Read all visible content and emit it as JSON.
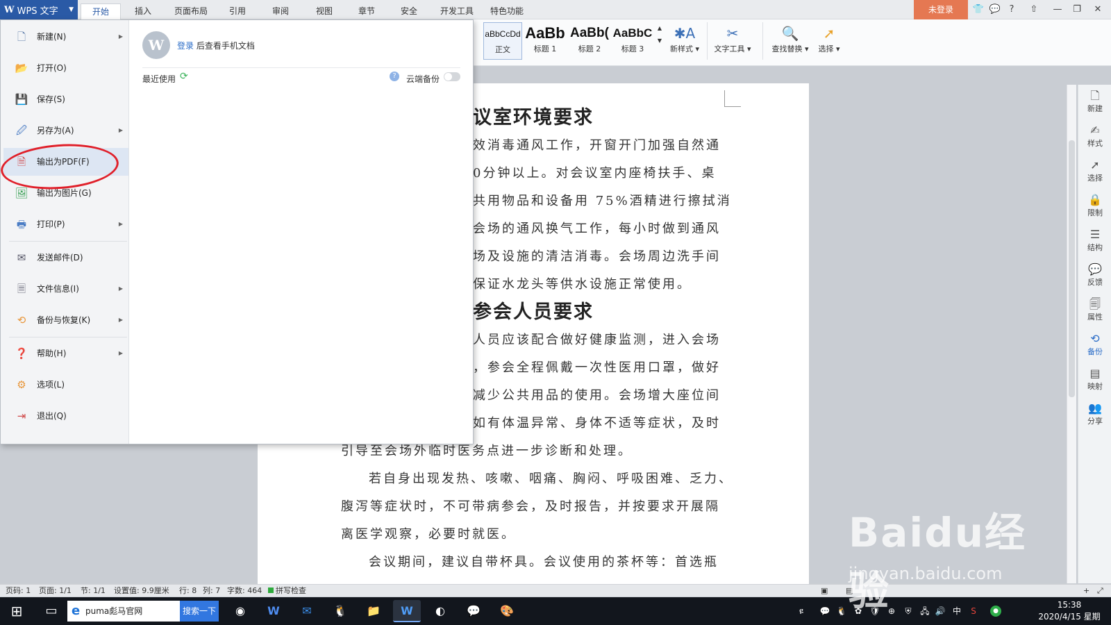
{
  "app": {
    "menu_label": "WPS 文字",
    "menu_logo": "W",
    "tabs": [
      "开始",
      "插入",
      "页面布局",
      "引用",
      "审阅",
      "视图",
      "章节",
      "安全",
      "开发工具",
      "特色功能"
    ],
    "login_label": "未登录"
  },
  "ribbon": {
    "styles": [
      {
        "preview": "aBbCcDd",
        "label": "正文"
      },
      {
        "preview": "AaBb",
        "label": "标题 1"
      },
      {
        "preview": "AaBb(",
        "label": "标题 2"
      },
      {
        "preview": "AaBbC",
        "label": "标题 3"
      }
    ],
    "tools": [
      "新样式 ▾",
      "文字工具 ▾",
      "查找替换 ▾",
      "选择 ▾"
    ]
  },
  "file_menu": {
    "items": [
      {
        "label": "新建(N)",
        "icon": "new-doc-icon",
        "arrow": true
      },
      {
        "label": "打开(O)",
        "icon": "folder-open-icon",
        "arrow": false
      },
      {
        "label": "保存(S)",
        "icon": "save-icon",
        "arrow": false
      },
      {
        "label": "另存为(A)",
        "icon": "save-as-icon",
        "arrow": true
      },
      {
        "label": "输出为PDF(F)",
        "icon": "pdf-export-icon",
        "arrow": false,
        "highlighted": true
      },
      {
        "label": "输出为图片(G)",
        "icon": "image-export-icon",
        "arrow": false
      },
      {
        "label": "打印(P)",
        "icon": "print-icon",
        "arrow": true
      },
      {
        "label": "发送邮件(D)",
        "icon": "mail-icon",
        "arrow": false
      },
      {
        "label": "文件信息(I)",
        "icon": "file-info-icon",
        "arrow": true
      },
      {
        "label": "备份与恢复(K)",
        "icon": "backup-icon",
        "arrow": true
      },
      {
        "label": "帮助(H)",
        "icon": "help-icon",
        "arrow": true
      },
      {
        "label": "选项(L)",
        "icon": "gear-icon",
        "arrow": false
      },
      {
        "label": "退出(Q)",
        "icon": "exit-icon",
        "arrow": false
      }
    ],
    "login_link": "登录",
    "login_text": " 后查看手机文档",
    "recent_label": "最近使用",
    "cloud_backup_label": "云端备份",
    "cloud_backup_enabled": false
  },
  "document": {
    "heading1": "议室环境要求",
    "para1": [
      "效消毒通风工作，开窗开门加强自然通",
      "0分钟以上。对会议室内座椅扶手、桌",
      "共用物品和设备用 75%酒精进行擦拭消",
      "会场的通风换气工作，每小时做到通风",
      "场及设施的清洁消毒。会场周边洗手间",
      "保证水龙头等供水设施正常使用。"
    ],
    "heading2": "参会人员要求",
    "para2": [
      "人员应该配合做好健康监测，进入会场",
      "，参会全程佩戴一次性医用口罩，做好",
      "减少公共用品的使用。会场增大座位间",
      "如有体温异常、身体不适等症状，及时",
      "引导至会场外临时医务点进一步诊断和处理。"
    ],
    "para3": [
      "若自身出现发热、咳嗽、咽痛、胸闷、呼吸困难、乏力、",
      "腹泻等症状时，不可带病参会，及时报告，并按要求开展隔",
      "离医学观察，必要时就医。"
    ],
    "para4": [
      "会议期间，建议自带杯具。会议使用的茶杯等：首选瓶"
    ]
  },
  "side_panel": [
    "新建",
    "样式",
    "选择",
    "限制",
    "结构",
    "反馈",
    "属性",
    "备份",
    "映射",
    "分享"
  ],
  "status_bar": {
    "page": "页码: 1",
    "pages": "页面: 1/1",
    "section": "节: 1/1",
    "setting": "设置值: 9.9厘米",
    "row": "行: 8",
    "col": "列: 7",
    "words": "字数: 464",
    "spell": "拼写检查"
  },
  "taskbar": {
    "search_text": "puma彪马官网",
    "search_button": "搜索一下",
    "time": "15:38",
    "date": "2020/4/15 星期三",
    "ime": "中"
  },
  "watermark": {
    "brand": "Baidu经验",
    "url": "jingyan.baidu.com"
  }
}
